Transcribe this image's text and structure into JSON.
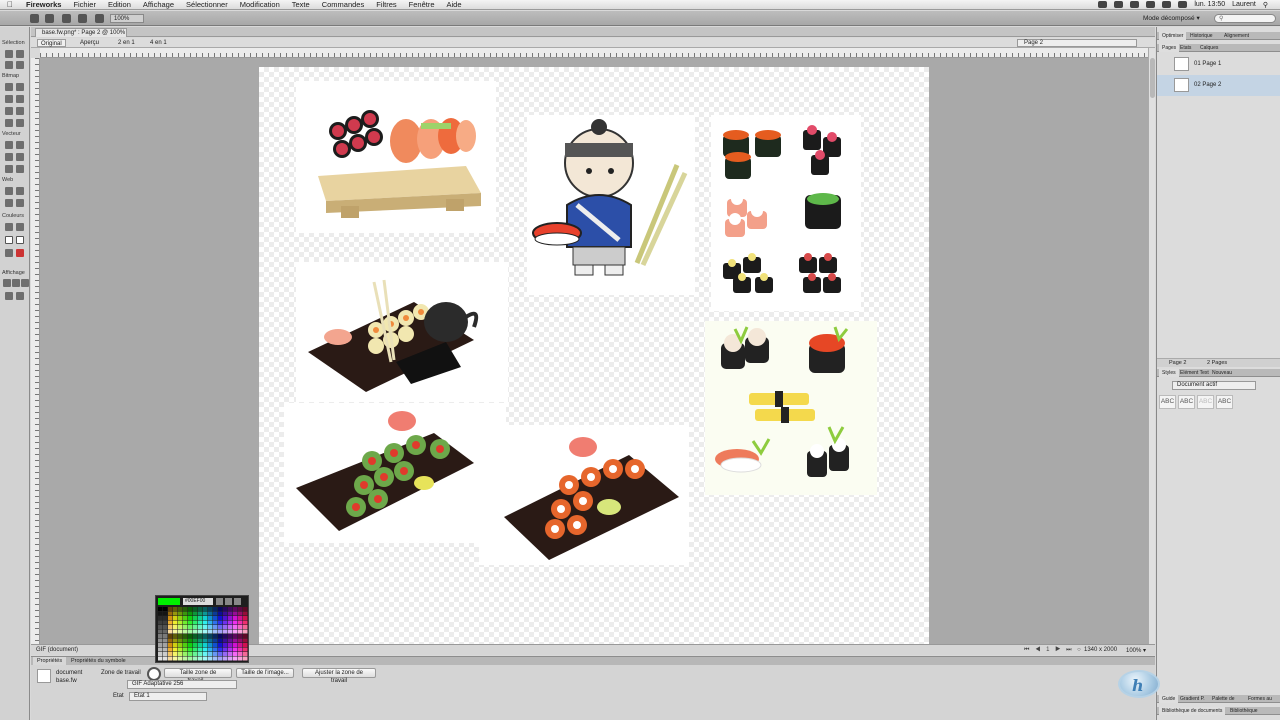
{
  "menubar": {
    "app": "Fireworks",
    "items": [
      "Fichier",
      "Edition",
      "Affichage",
      "Sélectionner",
      "Modification",
      "Texte",
      "Commandes",
      "Filtres",
      "Fenêtre",
      "Aide"
    ],
    "time": "lun. 13:50",
    "user": "Laurent"
  },
  "appbar": {
    "zoom": "100%",
    "mode": "Mode décomposé ▾"
  },
  "tools": {
    "sections": [
      "Sélection",
      "Bitmap",
      "Vecteur",
      "Web",
      "Couleurs",
      "Affichage"
    ]
  },
  "document": {
    "tab_title": "base.fw.png* : Page 2 @ 100%",
    "view_tabs": [
      "Original",
      "Aperçu",
      "2 en 1",
      "4 en 1"
    ],
    "page_selector": "Page 2"
  },
  "status": {
    "label": "GIF (document)",
    "nav": "⏮ ◀ 1 ▶ ⏭ ○",
    "dimensions": "1340 x 2000",
    "zoom": "100% ▾"
  },
  "properties": {
    "tabs": [
      "Propriétés",
      "Propriétés du symbole"
    ],
    "doc_label": "document",
    "doc_name": "base.fw",
    "zone_label": "Zone de travail",
    "buttons": [
      "Taille zone de travail...",
      "Taille de l'image...",
      "Ajuster la zone de travail"
    ],
    "gif_select": "GIF Adaptative 256",
    "etat_label": "Etat",
    "etat_select": "Etat 1"
  },
  "color_popup": {
    "hex": "#00EF00",
    "color": "#00ef00"
  },
  "right_panel": {
    "top_tabs": [
      "Optimiser",
      "Historique",
      "Alignement"
    ],
    "sub_tabs": [
      "Pages",
      "Etats",
      "Calques"
    ],
    "pages": [
      "01 Page 1",
      "02 Page 2"
    ],
    "pages_footer_sel": "Page 2",
    "pages_footer_count": "2 Pages",
    "styles_tabs": [
      "Styles",
      "Elément Text",
      "Nouveau"
    ],
    "styles_select": "Document actif",
    "abc_samples": [
      "ABC",
      "ABC",
      "ABC",
      "ABC"
    ],
    "bottom_tabs": [
      "Guide",
      "Gradient P.",
      "Palette de",
      "Formes au"
    ],
    "bottom_tabs2": [
      "Bibliothèque de documents",
      "Bibliothèque"
    ]
  },
  "images": [
    "sushi-plate-wood",
    "ninja-chef-cartoon",
    "sushi-icons-grid",
    "sushi-platter-teapot",
    "maki-plate-green",
    "maki-plate-red",
    "sushi-icons-illustrated"
  ]
}
